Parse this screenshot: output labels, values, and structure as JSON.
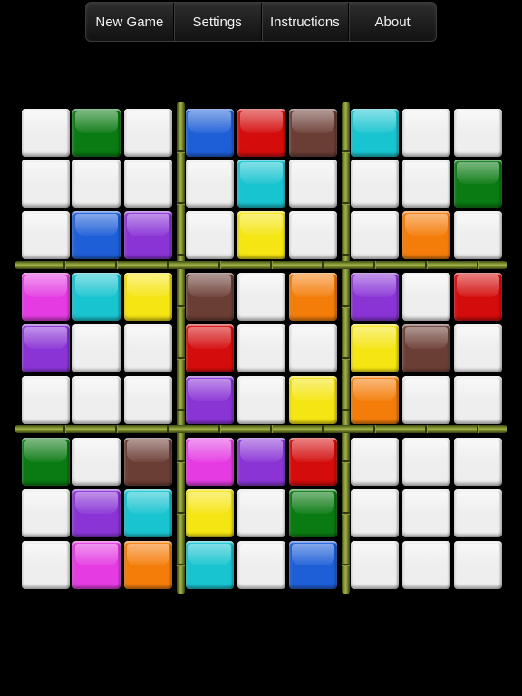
{
  "toolbar": {
    "new_game": "New Game",
    "settings": "Settings",
    "instructions": "Instructions",
    "about": "About"
  },
  "colors": {
    "W": "#eeeeee",
    "G": "#0a7a12",
    "B": "#1e5fd8",
    "R": "#d40c0c",
    "N": "#6b3e35",
    "C": "#18c4d0",
    "Y": "#f5e512",
    "O": "#f47d0a",
    "P": "#8a34d6",
    "M": "#e43ce2"
  },
  "board": [
    [
      "W",
      "G",
      "W",
      "B",
      "R",
      "N",
      "C",
      "W",
      "W"
    ],
    [
      "W",
      "W",
      "W",
      "W",
      "C",
      "W",
      "W",
      "W",
      "G"
    ],
    [
      "W",
      "B",
      "P",
      "W",
      "Y",
      "W",
      "W",
      "O",
      "W"
    ],
    [
      "M",
      "C",
      "Y",
      "N",
      "W",
      "O",
      "P",
      "W",
      "R"
    ],
    [
      "P",
      "W",
      "W",
      "R",
      "W",
      "W",
      "Y",
      "N",
      "W"
    ],
    [
      "W",
      "W",
      "W",
      "P",
      "W",
      "Y",
      "O",
      "W",
      "W"
    ],
    [
      "G",
      "W",
      "N",
      "M",
      "P",
      "R",
      "W",
      "W",
      "W"
    ],
    [
      "W",
      "P",
      "C",
      "Y",
      "W",
      "G",
      "W",
      "W",
      "W"
    ],
    [
      "W",
      "M",
      "O",
      "C",
      "W",
      "B",
      "W",
      "W",
      "W"
    ]
  ]
}
